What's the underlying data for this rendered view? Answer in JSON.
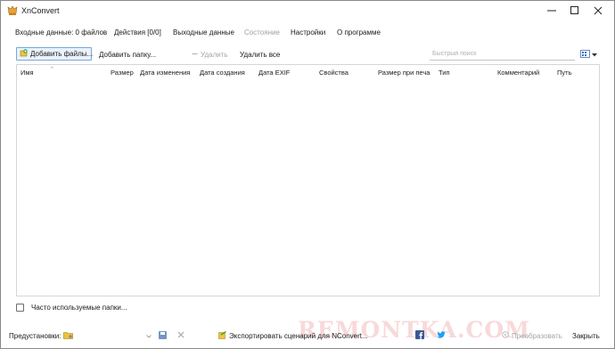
{
  "window": {
    "title": "XnConvert",
    "buttons": [
      "minimize",
      "maximize",
      "close"
    ]
  },
  "tabs": [
    {
      "label": "Входные данные: 0 файлов",
      "state": "active"
    },
    {
      "label": "Действия [0/0]",
      "state": "normal"
    },
    {
      "label": "Выходные данные",
      "state": "normal"
    },
    {
      "label": "Состояние",
      "state": "disabled"
    },
    {
      "label": "Настройки",
      "state": "normal"
    },
    {
      "label": "О программе",
      "state": "normal"
    }
  ],
  "toolbar": {
    "add_files": "Добавить файлы...",
    "add_folder": "Добавить папку...",
    "remove": "Удалить",
    "remove_all": "Удалить все",
    "search_placeholder": "Быстрый поиск",
    "search_value": ""
  },
  "file_list": {
    "columns": [
      "Имя",
      "Размер",
      "Дата изменения",
      "Дата создания",
      "Дата EXIF",
      "Свойства",
      "Размер при печа",
      "Тип",
      "Комментарий",
      "Путь"
    ],
    "rows": []
  },
  "bottom": {
    "frequent_folders": "Часто используемые папки...",
    "frequent_folders_checked": false,
    "presets_label": "Предустановки:",
    "export_label": "Экспортировать сценарий для NConvert...",
    "convert_label": "Преобразовать",
    "close_label": "Закрыть"
  },
  "watermark": "REMONTKA.COM",
  "colors": {
    "accent": "#7aa7d9",
    "add_button_bg": "#eaf2fb",
    "disabled_text": "#a6a6a6",
    "facebook": "#3b5998",
    "twitter": "#1da1f2"
  },
  "icons": {
    "app": "xnconvert-logo-icon",
    "add_files": "add-files-icon",
    "remove": "remove-icon",
    "view": "view-mode-icon",
    "presets_dropdown": "chevron-down-icon",
    "presets_load": "folder-open-icon",
    "presets_save": "save-disk-icon",
    "presets_delete": "delete-x-icon",
    "export": "export-script-icon",
    "facebook": "facebook-icon",
    "twitter": "twitter-icon",
    "convert": "convert-icon"
  }
}
